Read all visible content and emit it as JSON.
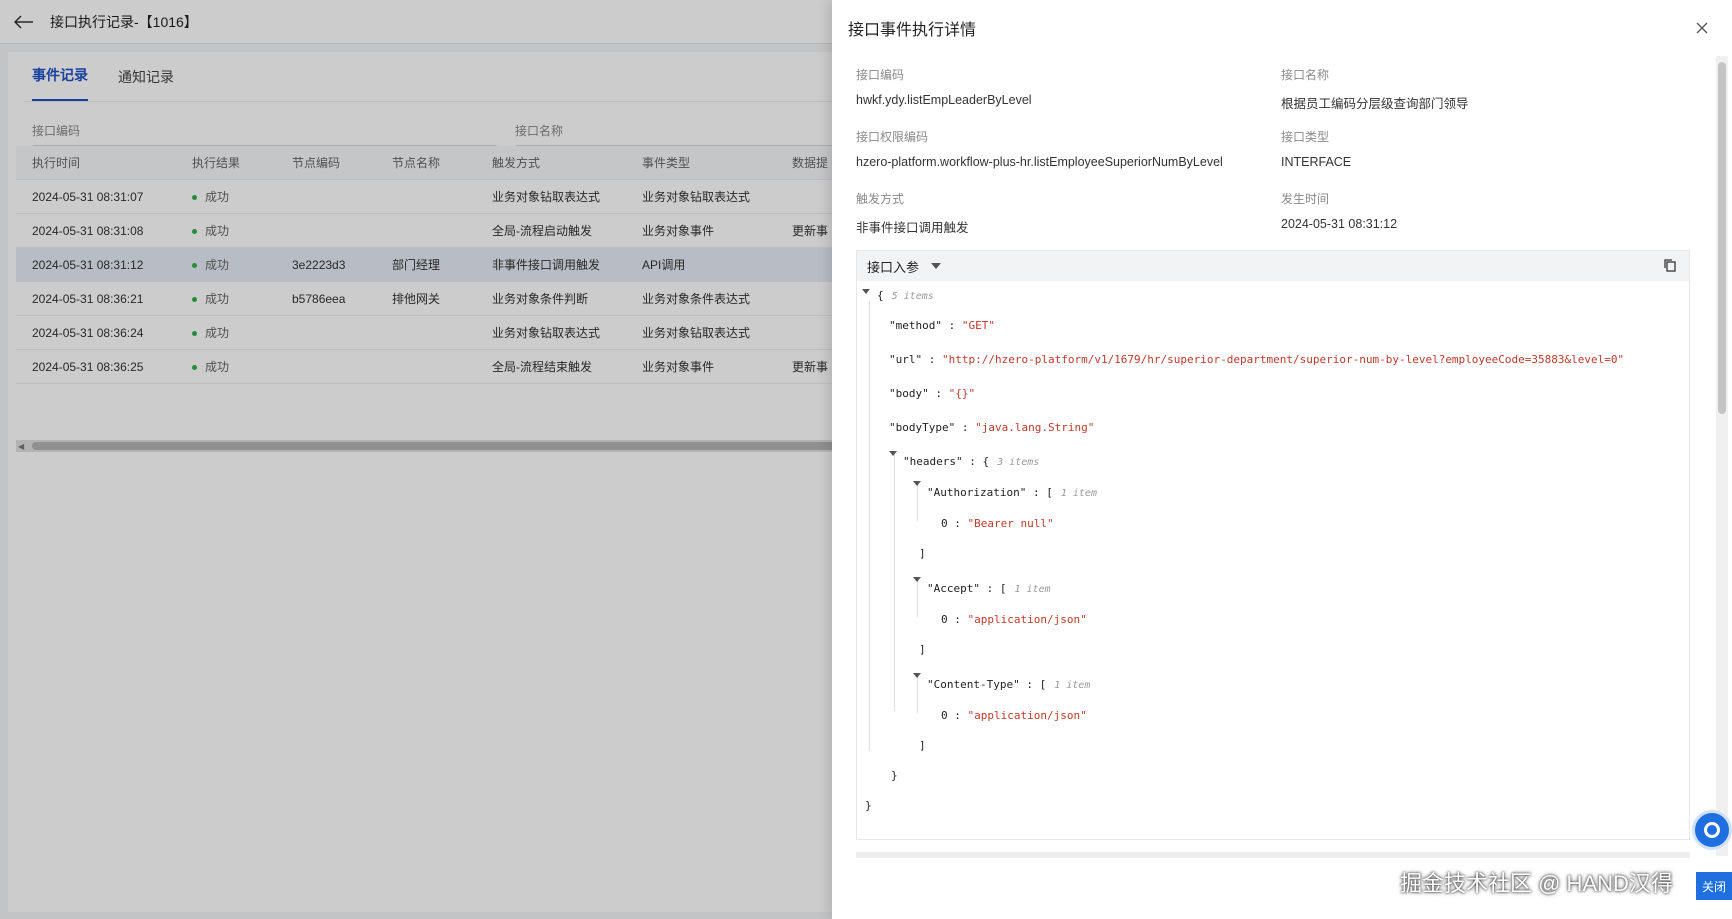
{
  "page": {
    "title": "接口执行记录-【1016】",
    "tabs": [
      {
        "label": "事件记录",
        "active": true
      },
      {
        "label": "通知记录",
        "active": false
      }
    ],
    "filters": [
      {
        "label": "接口编码",
        "value": ""
      },
      {
        "label": "接口名称",
        "value": ""
      }
    ],
    "table": {
      "headers": [
        "执行时间",
        "执行结果",
        "节点编码",
        "节点名称",
        "触发方式",
        "事件类型",
        "数据提"
      ],
      "rows": [
        {
          "time": "2024-05-31 08:31:07",
          "status": "成功",
          "node_code": "",
          "node_name": "",
          "trigger": "业务对象钻取表达式",
          "event": "业务对象钻取表达式",
          "extra": ""
        },
        {
          "time": "2024-05-31 08:31:08",
          "status": "成功",
          "node_code": "",
          "node_name": "",
          "trigger": "全局-流程启动触发",
          "event": "业务对象事件",
          "extra": "更新事"
        },
        {
          "time": "2024-05-31 08:31:12",
          "status": "成功",
          "node_code": "3e2223d3",
          "node_name": "部门经理",
          "trigger": "非事件接口调用触发",
          "event": "API调用",
          "extra": ""
        },
        {
          "time": "2024-05-31 08:36:21",
          "status": "成功",
          "node_code": "b5786eea",
          "node_name": "排他网关",
          "trigger": "业务对象条件判断",
          "event": "业务对象条件表达式",
          "extra": ""
        },
        {
          "time": "2024-05-31 08:36:24",
          "status": "成功",
          "node_code": "",
          "node_name": "",
          "trigger": "业务对象钻取表达式",
          "event": "业务对象钻取表达式",
          "extra": ""
        },
        {
          "time": "2024-05-31 08:36:25",
          "status": "成功",
          "node_code": "",
          "node_name": "",
          "trigger": "全局-流程结束触发",
          "event": "业务对象事件",
          "extra": "更新事"
        }
      ]
    }
  },
  "drawer": {
    "title": "接口事件执行详情",
    "fields": [
      {
        "label": "接口编码",
        "value": "hwkf.ydy.listEmpLeaderByLevel"
      },
      {
        "label": "接口名称",
        "value": "根据员工编码分层级查询部门领导"
      },
      {
        "label": "接口权限编码",
        "value": "hzero-platform.workflow-plus-hr.listEmployeeSuperiorNumByLevel"
      },
      {
        "label": "接口类型",
        "value": "INTERFACE"
      },
      {
        "label": "触发方式",
        "value": "非事件接口调用触发"
      },
      {
        "label": "发生时间",
        "value": "2024-05-31 08:31:12"
      }
    ],
    "panel_title": "接口入参",
    "json": {
      "root_count": "5 items",
      "method_key": "\"method\"",
      "method_val": "\"GET\"",
      "url_key": "\"url\"",
      "url_val": "\"http://hzero-platform/v1/1679/hr/superior-department/superior-num-by-level?employeeCode=35883&level=0\"",
      "body_key": "\"body\"",
      "body_val": "\"{}\"",
      "bodytype_key": "\"bodyType\"",
      "bodytype_val": "\"java.lang.String\"",
      "headers_key": "\"headers\"",
      "headers_count": "3 items",
      "auth_key": "\"Authorization\"",
      "auth_count": "1 item",
      "auth_val": "\"Bearer null\"",
      "accept_key": "\"Accept\"",
      "accept_count": "1 item",
      "accept_val": "\"application/json\"",
      "ctype_key": "\"Content-Type\"",
      "ctype_count": "1 item",
      "ctype_val": "\"application/json\"",
      "index": "0"
    }
  },
  "watermark": "掘金技术社区 @ HAND汉得",
  "close_button": "关闭"
}
